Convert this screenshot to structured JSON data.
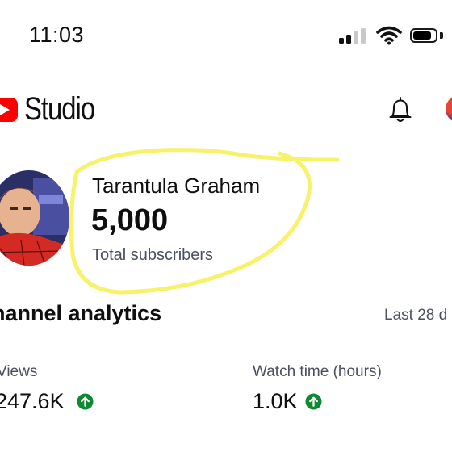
{
  "status_bar": {
    "time": "11:03",
    "battery_level": 0.85,
    "signal_bars": "3 of 4"
  },
  "header": {
    "app_name": "Studio",
    "logo_color": "#ff0000",
    "bell_icon": "notifications-bell-icon",
    "avatar_icon": "account-avatar"
  },
  "channel": {
    "name": "Tarantula Graham",
    "subscriber_count": "5,000",
    "subscriber_label": "Total subscribers",
    "highlight_color": "#f7f26a"
  },
  "analytics": {
    "title": "hannel analytics",
    "range": "Last 28 d",
    "metrics": [
      {
        "label": "Views",
        "value": "247.6K",
        "trend_icon": "arrow-up-circle-icon",
        "trend_color": "#0b8a2f"
      },
      {
        "label": "Watch time (hours)",
        "value": "1.0K",
        "trend_icon": "arrow-up-circle-icon",
        "trend_color": "#0b8a2f"
      }
    ]
  }
}
